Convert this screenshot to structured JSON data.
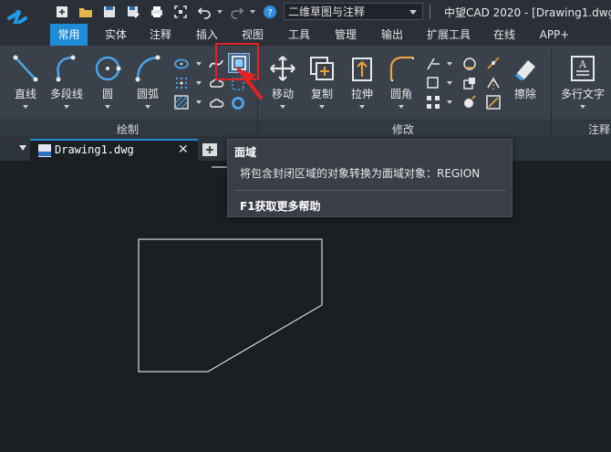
{
  "app": {
    "title": "中望CAD 2020 - [Drawing1.dwg]",
    "workspace": "二维草图与注释"
  },
  "menu": {
    "tabs": [
      "常用",
      "实体",
      "注释",
      "插入",
      "视图",
      "工具",
      "管理",
      "输出",
      "扩展工具",
      "在线",
      "APP+"
    ],
    "active": "常用"
  },
  "ribbon": {
    "groups": {
      "draw": "绘制",
      "modify": "修改",
      "annotate": "注释"
    },
    "buttons": {
      "line": "直线",
      "polyline": "多段线",
      "circle": "圆",
      "arc": "圆弧",
      "move": "移动",
      "copy": "复制",
      "stretch": "拉伸",
      "fillet": "圆角",
      "erase": "擦除",
      "mtext": "多行文字"
    }
  },
  "document": {
    "tab_name": "Drawing1.dwg",
    "close_glyph": "✕"
  },
  "tooltip": {
    "title": "面域",
    "description": "将包含封闭区域的对象转换为面域对象：REGION",
    "help": "F1获取更多帮助"
  },
  "colors": {
    "accent": "#1e8cd6",
    "highlight": "#e02424",
    "canvas": "#1b1f24",
    "ribbon": "#3a414a"
  }
}
